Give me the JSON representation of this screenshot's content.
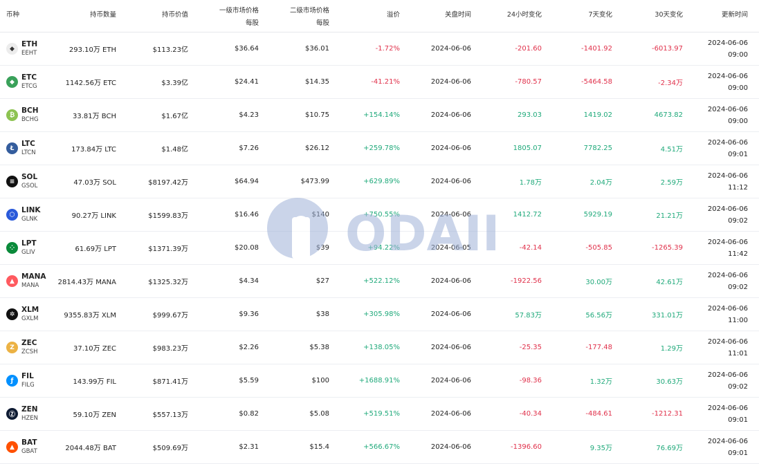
{
  "header": {
    "symbol": "币种",
    "holdings": "持币数量",
    "value": "持币价值",
    "primary_price": [
      "一级市场价格",
      "每股"
    ],
    "secondary_price": [
      "二级市场价格",
      "每股"
    ],
    "premium": "溢价",
    "close_time": "关盘时间",
    "change_24h": "24小时变化",
    "change_7d": "7天变化",
    "change_30d": "30天变化",
    "updated": "更新时间"
  },
  "watermark": "ODAILY",
  "colors": {
    "negative": "#e0304a",
    "positive": "#1fa97a"
  },
  "rows": [
    {
      "name": "ETH",
      "sub": "EEHT",
      "icon": "ethereum-icon",
      "icon_color": "#ececec",
      "glyph": "◆",
      "holdings": "293.10万 ETH",
      "value": "$113.23亿",
      "p1": "$36.64",
      "p2": "$36.01",
      "premium": "-1.72%",
      "premium_dir": "neg",
      "close": "2024-06-06",
      "c24": "-201.60",
      "c24_dir": "neg",
      "c7": "-1401.92",
      "c7_dir": "neg",
      "c30": "-6013.97",
      "c30_dir": "neg",
      "date": "2024-06-06",
      "time": "09:00"
    },
    {
      "name": "ETC",
      "sub": "ETCG",
      "icon": "ethereum-classic-icon",
      "icon_color": "#3aa15a",
      "glyph": "◆",
      "holdings": "1142.56万 ETC",
      "value": "$3.39亿",
      "p1": "$24.41",
      "p2": "$14.35",
      "premium": "-41.21%",
      "premium_dir": "neg",
      "close": "2024-06-06",
      "c24": "-780.57",
      "c24_dir": "neg",
      "c7": "-5464.58",
      "c7_dir": "neg",
      "c30": "-2.34万",
      "c30_dir": "neg",
      "date": "2024-06-06",
      "time": "09:00"
    },
    {
      "name": "BCH",
      "sub": "BCHG",
      "icon": "bitcoin-cash-icon",
      "icon_color": "#8dc351",
      "glyph": "₿",
      "holdings": "33.81万 BCH",
      "value": "$1.67亿",
      "p1": "$4.23",
      "p2": "$10.75",
      "premium": "+154.14%",
      "premium_dir": "pos",
      "close": "2024-06-06",
      "c24": "293.03",
      "c24_dir": "pos",
      "c7": "1419.02",
      "c7_dir": "pos",
      "c30": "4673.82",
      "c30_dir": "pos",
      "date": "2024-06-06",
      "time": "09:00"
    },
    {
      "name": "LTC",
      "sub": "LTCN",
      "icon": "litecoin-icon",
      "icon_color": "#345d9d",
      "glyph": "Ł",
      "holdings": "173.84万 LTC",
      "value": "$1.48亿",
      "p1": "$7.26",
      "p2": "$26.12",
      "premium": "+259.78%",
      "premium_dir": "pos",
      "close": "2024-06-06",
      "c24": "1805.07",
      "c24_dir": "pos",
      "c7": "7782.25",
      "c7_dir": "pos",
      "c30": "4.51万",
      "c30_dir": "pos",
      "date": "2024-06-06",
      "time": "09:01"
    },
    {
      "name": "SOL",
      "sub": "GSOL",
      "icon": "solana-icon",
      "icon_color": "#111111",
      "glyph": "≡",
      "holdings": "47.03万 SOL",
      "value": "$8197.42万",
      "p1": "$64.94",
      "p2": "$473.99",
      "premium": "+629.89%",
      "premium_dir": "pos",
      "close": "2024-06-06",
      "c24": "1.78万",
      "c24_dir": "pos",
      "c7": "2.04万",
      "c7_dir": "pos",
      "c30": "2.59万",
      "c30_dir": "pos",
      "date": "2024-06-06",
      "time": "11:12"
    },
    {
      "name": "LINK",
      "sub": "GLNK",
      "icon": "chainlink-icon",
      "icon_color": "#2a5ada",
      "glyph": "⬡",
      "holdings": "90.27万 LINK",
      "value": "$1599.83万",
      "p1": "$16.46",
      "p2": "$140",
      "premium": "+750.55%",
      "premium_dir": "pos",
      "close": "2024-06-06",
      "c24": "1412.72",
      "c24_dir": "pos",
      "c7": "5929.19",
      "c7_dir": "pos",
      "c30": "21.21万",
      "c30_dir": "pos",
      "date": "2024-06-06",
      "time": "09:02"
    },
    {
      "name": "LPT",
      "sub": "GLIV",
      "icon": "livepeer-icon",
      "icon_color": "#0a8a3a",
      "glyph": "⁘",
      "holdings": "61.69万 LPT",
      "value": "$1371.39万",
      "p1": "$20.08",
      "p2": "$39",
      "premium": "+94.22%",
      "premium_dir": "pos",
      "close": "2024-06-05",
      "c24": "-42.14",
      "c24_dir": "neg",
      "c7": "-505.85",
      "c7_dir": "neg",
      "c30": "-1265.39",
      "c30_dir": "neg",
      "date": "2024-06-06",
      "time": "11:42"
    },
    {
      "name": "MANA",
      "sub": "MANA",
      "icon": "decentraland-icon",
      "icon_color": "#ff5a5f",
      "glyph": "▲",
      "holdings": "2814.43万 MANA",
      "value": "$1325.32万",
      "p1": "$4.34",
      "p2": "$27",
      "premium": "+522.12%",
      "premium_dir": "pos",
      "close": "2024-06-06",
      "c24": "-1922.56",
      "c24_dir": "neg",
      "c7": "30.00万",
      "c7_dir": "pos",
      "c30": "42.61万",
      "c30_dir": "pos",
      "date": "2024-06-06",
      "time": "09:02"
    },
    {
      "name": "XLM",
      "sub": "GXLM",
      "icon": "stellar-icon",
      "icon_color": "#111111",
      "glyph": "✲",
      "holdings": "9355.83万 XLM",
      "value": "$999.67万",
      "p1": "$9.36",
      "p2": "$38",
      "premium": "+305.98%",
      "premium_dir": "pos",
      "close": "2024-06-06",
      "c24": "57.83万",
      "c24_dir": "pos",
      "c7": "56.56万",
      "c7_dir": "pos",
      "c30": "331.01万",
      "c30_dir": "pos",
      "date": "2024-06-06",
      "time": "11:00"
    },
    {
      "name": "ZEC",
      "sub": "ZCSH",
      "icon": "zcash-icon",
      "icon_color": "#ecb244",
      "glyph": "Z",
      "holdings": "37.10万 ZEC",
      "value": "$983.23万",
      "p1": "$2.26",
      "p2": "$5.38",
      "premium": "+138.05%",
      "premium_dir": "pos",
      "close": "2024-06-06",
      "c24": "-25.35",
      "c24_dir": "neg",
      "c7": "-177.48",
      "c7_dir": "neg",
      "c30": "1.29万",
      "c30_dir": "pos",
      "date": "2024-06-06",
      "time": "11:01"
    },
    {
      "name": "FIL",
      "sub": "FILG",
      "icon": "filecoin-icon",
      "icon_color": "#0090ff",
      "glyph": "ƒ",
      "holdings": "143.99万 FIL",
      "value": "$871.41万",
      "p1": "$5.59",
      "p2": "$100",
      "premium": "+1688.91%",
      "premium_dir": "pos",
      "close": "2024-06-06",
      "c24": "-98.36",
      "c24_dir": "neg",
      "c7": "1.32万",
      "c7_dir": "pos",
      "c30": "30.63万",
      "c30_dir": "pos",
      "date": "2024-06-06",
      "time": "09:02"
    },
    {
      "name": "ZEN",
      "sub": "HZEN",
      "icon": "horizen-icon",
      "icon_color": "#0e1b33",
      "glyph": "Ⓩ",
      "holdings": "59.10万 ZEN",
      "value": "$557.13万",
      "p1": "$0.82",
      "p2": "$5.08",
      "premium": "+519.51%",
      "premium_dir": "pos",
      "close": "2024-06-06",
      "c24": "-40.34",
      "c24_dir": "neg",
      "c7": "-484.61",
      "c7_dir": "neg",
      "c30": "-1212.31",
      "c30_dir": "neg",
      "date": "2024-06-06",
      "time": "09:01"
    },
    {
      "name": "BAT",
      "sub": "GBAT",
      "icon": "basic-attention-token-icon",
      "icon_color": "#ff5000",
      "glyph": "▲",
      "holdings": "2044.48万 BAT",
      "value": "$509.69万",
      "p1": "$2.31",
      "p2": "$15.4",
      "premium": "+566.67%",
      "premium_dir": "pos",
      "close": "2024-06-06",
      "c24": "-1396.60",
      "c24_dir": "neg",
      "c7": "9.35万",
      "c7_dir": "pos",
      "c30": "76.69万",
      "c30_dir": "pos",
      "date": "2024-06-06",
      "time": "09:01"
    }
  ]
}
